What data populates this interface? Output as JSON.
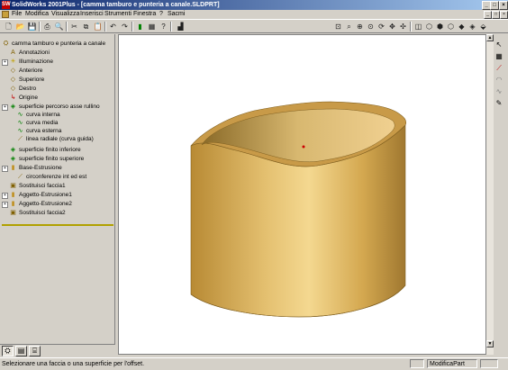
{
  "window": {
    "title": "SolidWorks 2001Plus - [camma tamburo e punteria a canale.SLDPRT]",
    "app_icon": "SW",
    "controls": [
      "_",
      "□",
      "×"
    ]
  },
  "menubar": {
    "items": [
      "File",
      "Modifica",
      "Visualizza",
      "Inserisci",
      "Strumenti",
      "Finestra",
      "?",
      "Sacmi"
    ],
    "doc_controls": [
      "_",
      "□",
      "×"
    ]
  },
  "toolbar": {
    "icons": [
      "new-file-icon",
      "open-icon",
      "save-icon",
      "print-icon",
      "print-preview-icon",
      "cut-icon",
      "copy-icon",
      "paste-icon",
      "undo-icon",
      "redo-icon",
      "rebuild-icon",
      "options-icon",
      "help-icon",
      "sketch-icon",
      "zoom-fit-icon",
      "zoom-area-icon",
      "zoom-in-out-icon",
      "zoom-select-icon",
      "rotate-icon",
      "pan-icon",
      "standard-views-icon",
      "view-front-icon",
      "view-iso-icon",
      "wireframe-icon",
      "hidden-lines-icon",
      "shaded-icon",
      "perspective-icon",
      "section-icon"
    ]
  },
  "tree": {
    "root": "camma tamburo e punteria a canale",
    "items": [
      {
        "label": "Annotazioni",
        "icon": "annotations-icon"
      },
      {
        "label": "Illuminazione",
        "icon": "lighting-icon"
      },
      {
        "label": "Anteriore",
        "icon": "plane-icon"
      },
      {
        "label": "Superiore",
        "icon": "plane-icon"
      },
      {
        "label": "Destro",
        "icon": "plane-icon"
      },
      {
        "label": "Origine",
        "icon": "origin-icon"
      },
      {
        "label": "superficie percorso asse rullino",
        "icon": "surface-icon"
      },
      {
        "label": "curva interna",
        "icon": "curve-icon"
      },
      {
        "label": "curva media",
        "icon": "curve-icon"
      },
      {
        "label": "curva esterna",
        "icon": "curve-icon"
      },
      {
        "label": "linea radiale (curva guida)",
        "icon": "sketch-icon"
      },
      {
        "label": "superficie finito inferiore",
        "icon": "surface-icon"
      },
      {
        "label": "superficie finito superiore",
        "icon": "surface-icon"
      },
      {
        "label": "Base-Estrusione",
        "icon": "extrude-icon"
      },
      {
        "label": "circonferenze int ed est",
        "icon": "sketch-icon"
      },
      {
        "label": "Sostituisci faccia1",
        "icon": "replace-face-icon"
      },
      {
        "label": "Aggetto-Estrusione1",
        "icon": "extrude-icon"
      },
      {
        "label": "Aggetto-Estrusione2",
        "icon": "extrude-icon"
      },
      {
        "label": "Sostituisci faccia2",
        "icon": "replace-face-icon"
      }
    ]
  },
  "panel_tabs": [
    "feature-manager-tab",
    "property-manager-tab",
    "configuration-manager-tab"
  ],
  "status": {
    "message": "Selezionare una faccia o una superficie per l'offset.",
    "mode": "ModificaPart"
  },
  "colors": {
    "part_base": "#d4a850",
    "part_light": "#f6dc90",
    "part_dark": "#a07830",
    "title_start": "#0a246a",
    "title_end": "#a6caf0"
  }
}
